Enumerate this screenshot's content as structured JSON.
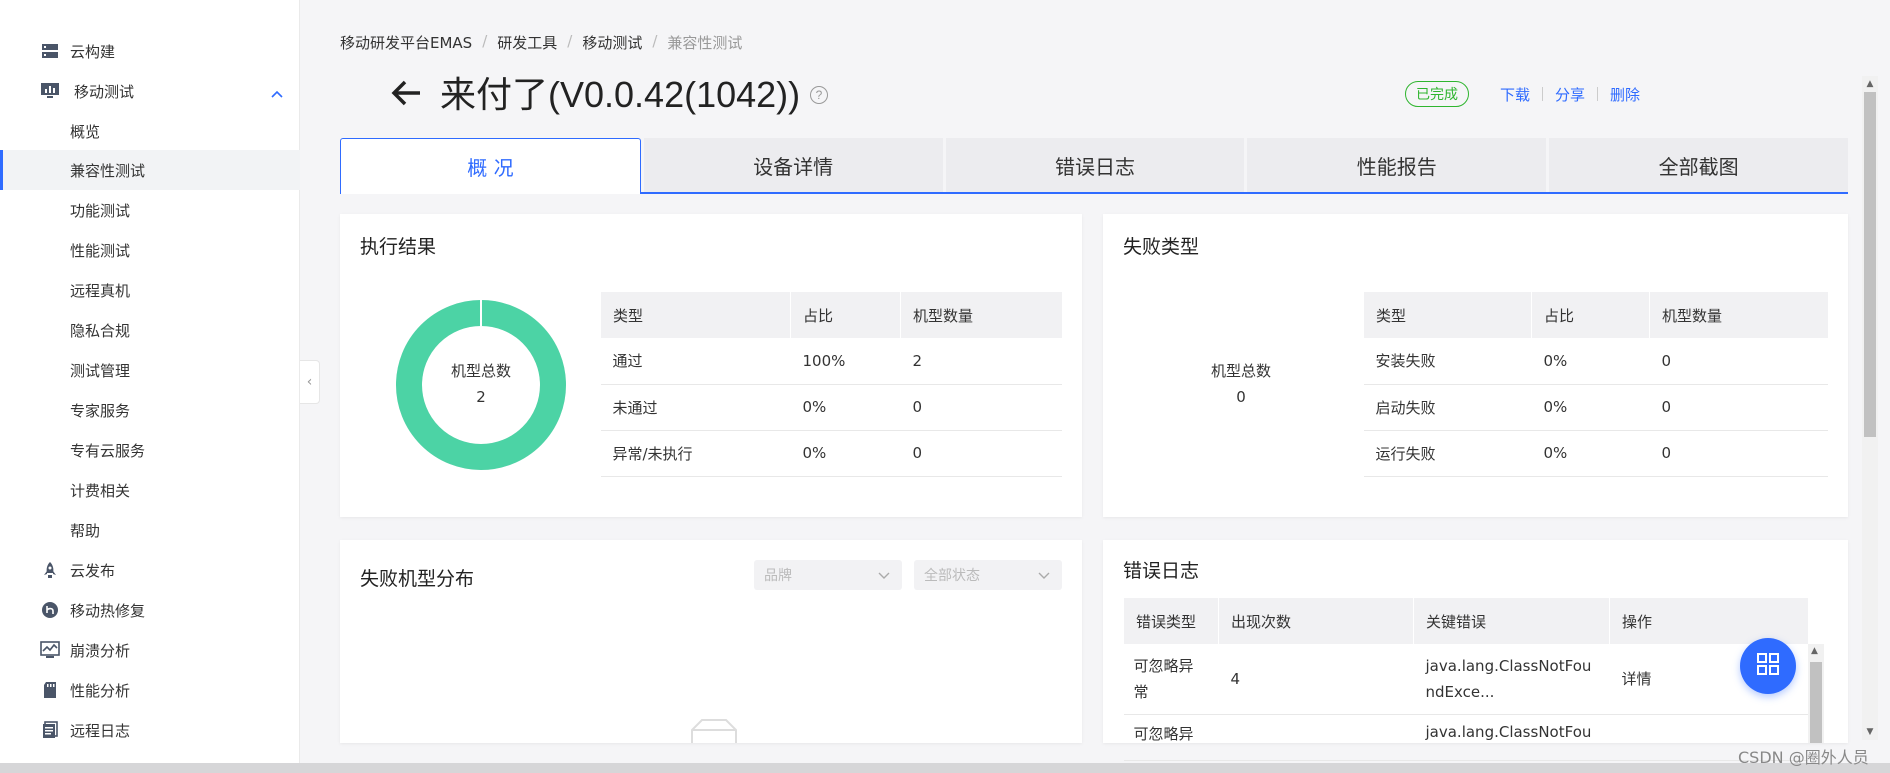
{
  "sidebar": {
    "items": [
      {
        "label": "云构建",
        "icon": "server-icon"
      },
      {
        "label": "移动测试",
        "icon": "monitor-icon"
      },
      {
        "label": "概览"
      },
      {
        "label": "兼容性测试"
      },
      {
        "label": "功能测试"
      },
      {
        "label": "性能测试"
      },
      {
        "label": "远程真机"
      },
      {
        "label": "隐私合规"
      },
      {
        "label": "测试管理"
      },
      {
        "label": "专家服务"
      },
      {
        "label": "专有云服务"
      },
      {
        "label": "计费相关"
      },
      {
        "label": "帮助"
      },
      {
        "label": "云发布",
        "icon": "rocket-icon"
      },
      {
        "label": "移动热修复",
        "icon": "hotfix-icon"
      },
      {
        "label": "崩溃分析",
        "icon": "chart-monitor-icon"
      },
      {
        "label": "性能分析",
        "icon": "sdcard-icon"
      },
      {
        "label": "远程日志",
        "icon": "document-icon"
      }
    ],
    "collapse_glyph": "‹"
  },
  "breadcrumb": [
    "移动研发平台EMAS",
    "研发工具",
    "移动测试",
    "兼容性测试"
  ],
  "breadcrumb_sep": "/",
  "page": {
    "title": "来付了(V0.0.42(1042))",
    "help": "?",
    "status": "已完成",
    "actions": [
      "下载",
      "分享",
      "删除"
    ]
  },
  "tabs": [
    "概 况",
    "设备详情",
    "错误日志",
    "性能报告",
    "全部截图"
  ],
  "exec_result": {
    "title": "执行结果",
    "center_label": "机型总数",
    "center_value": "2",
    "headers": [
      "类型",
      "占比",
      "机型数量"
    ],
    "rows": [
      [
        "通过",
        "100%",
        "2"
      ],
      [
        "未通过",
        "0%",
        "0"
      ],
      [
        "异常/未执行",
        "0%",
        "0"
      ]
    ],
    "pass_color": "#4cd3a5",
    "pass_fraction": 1.0
  },
  "fail_type": {
    "title": "失败类型",
    "center_label": "机型总数",
    "center_value": "0",
    "headers": [
      "类型",
      "占比",
      "机型数量"
    ],
    "rows": [
      [
        "安装失败",
        "0%",
        "0"
      ],
      [
        "启动失败",
        "0%",
        "0"
      ],
      [
        "运行失败",
        "0%",
        "0"
      ]
    ]
  },
  "fail_dist": {
    "title": "失败机型分布",
    "brand_placeholder": "品牌",
    "status_placeholder": "全部状态"
  },
  "error_log": {
    "title": "错误日志",
    "headers": [
      "错误类型",
      "出现次数",
      "关键错误",
      "操作"
    ],
    "rows": [
      {
        "type1": "可忽略异",
        "type2": "常",
        "count": "4",
        "err1": "java.lang.ClassNotFou",
        "err2": "ndExce...",
        "action": "详情"
      },
      {
        "type1": "可忽略异",
        "type2": "",
        "count": "",
        "err1": "java.lang.ClassNotFou",
        "err2": "",
        "action": ""
      }
    ]
  },
  "watermark": "CSDN @圈外人员",
  "colors": {
    "accent": "#2f6bff",
    "success": "#2fb52f"
  }
}
